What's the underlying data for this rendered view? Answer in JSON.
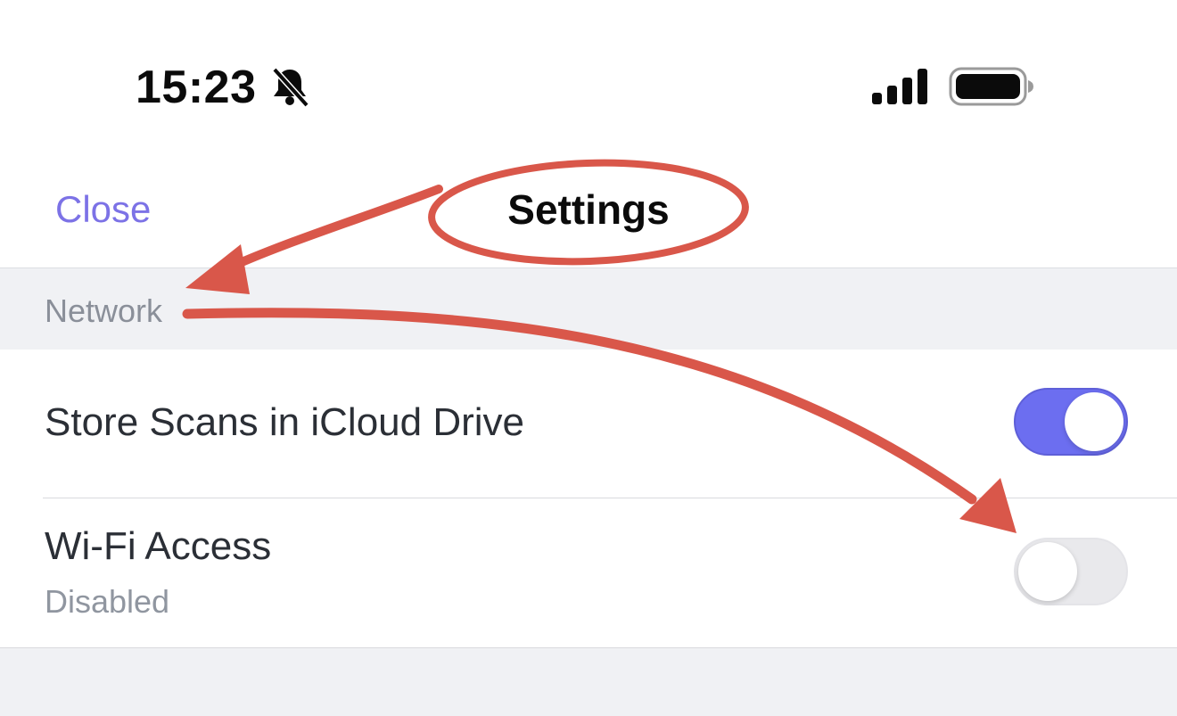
{
  "status_bar": {
    "time": "15:23",
    "icons": [
      "bell-slash-icon",
      "cellular-signal-icon",
      "battery-icon"
    ]
  },
  "nav": {
    "close_label": "Close",
    "title": "Settings"
  },
  "section": {
    "header": "Network"
  },
  "rows": [
    {
      "title": "Store Scans in iCloud Drive",
      "toggle_on": true
    },
    {
      "title": "Wi-Fi Access",
      "subtitle": "Disabled",
      "toggle_on": false
    }
  ],
  "colors": {
    "accent": "#7c72e6",
    "toggle_on": "#6c6ef0",
    "annotation": "#d9574a"
  }
}
